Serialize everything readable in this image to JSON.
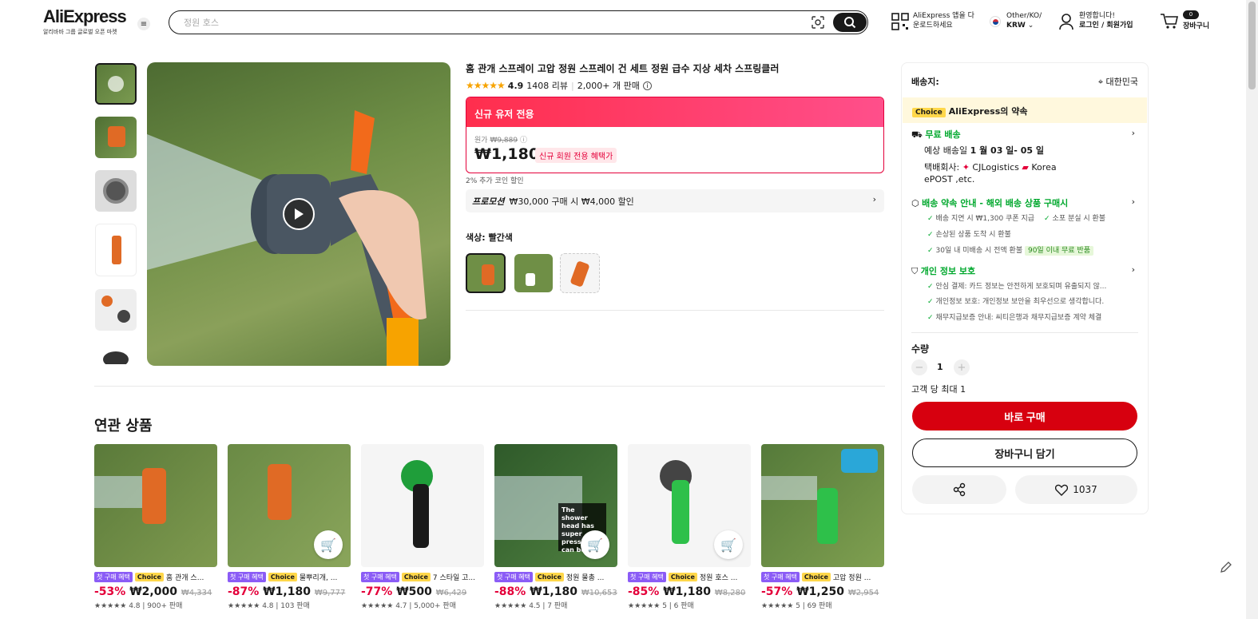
{
  "header": {
    "logo": "AliExpress",
    "logo_sub": "알리바바 그룹 글로벌 오픈 마켓",
    "search_placeholder": "정원 호스",
    "app_line1": "AliExpress 앱을 다",
    "app_line2": "운로드하세요",
    "region_line1": "Other/KO/",
    "region_line2": "KRW",
    "user_line1": "환영합니다!",
    "user_line2": "로그인 / 회원가입",
    "cart_count": "0",
    "cart_label": "장바구니"
  },
  "product": {
    "title": "홈 관개 스프레이 고압 정원 스프레이 건 세트 정원 급수 지상 세차 스프링클러",
    "stars": "★★★★★",
    "rating": "4.9",
    "reviews": "1408 리뷰",
    "sold": "2,000+ 개 판매",
    "promo_header": "신규 유저 전용",
    "original_label": "원가",
    "original_price": "₩9,889",
    "price": "₩1,180",
    "price_tag": "신규 회원 전용 혜택가",
    "coin": "2% 추가 코인 할인",
    "promotion_label": "프로모션",
    "promotion_text": "₩30,000 구매 시 ₩4,000 할인",
    "color_label": "색상: 빨간색"
  },
  "related": {
    "title": "연관 상품",
    "items": [
      {
        "badge1": "첫 구매 혜택",
        "badge2": "Choice",
        "name": "홈 관개 스...",
        "discount": "-53%",
        "price": "₩2,000",
        "orig": "₩4,334",
        "rating": "★★★★★ 4.8 | 900+ 판매"
      },
      {
        "badge1": "첫 구매 혜택",
        "badge2": "Choice",
        "name": "물뿌리개, ...",
        "discount": "-87%",
        "price": "₩1,180",
        "orig": "₩9,777",
        "rating": "★★★★★ 4.8 | 103 판매"
      },
      {
        "badge1": "첫 구매 혜택",
        "badge2": "Choice",
        "name": "7 스타일 고...",
        "discount": "-77%",
        "price": "₩500",
        "orig": "₩6,429",
        "rating": "★★★★★ 4.7 | 5,000+ 판매"
      },
      {
        "badge1": "첫 구매 혜택",
        "badge2": "Choice",
        "name": "정원 물총 ...",
        "discount": "-88%",
        "price": "₩1,180",
        "orig": "₩10,653",
        "rating": "★★★★★ 4.5 | 7 판매"
      },
      {
        "badge1": "첫 구매 혜택",
        "badge2": "Choice",
        "name": "정원 호스 ...",
        "discount": "-85%",
        "price": "₩1,180",
        "orig": "₩8,280",
        "rating": "★★★★★ 5 | 6 판매"
      },
      {
        "badge1": "첫 구매 혜택",
        "badge2": "Choice",
        "name": "고압 정원 ...",
        "discount": "-57%",
        "price": "₩1,250",
        "orig": "₩2,954",
        "rating": "★★★★★ 5 | 69 판매"
      }
    ],
    "overlay_text": "The shower head has super pressure can be"
  },
  "panel": {
    "ship_to_label": "배송지:",
    "ship_to_value": "대한민국",
    "choice_badge": "Choice",
    "choice_title": "AliExpress의 약속",
    "free_ship": "무료 배송",
    "eta_prefix": "예상 배송일",
    "eta": "1 월 03 일- 05 일",
    "carrier_label": "택배회사:",
    "carrier1": "CJLogistics",
    "carrier2": "Korea",
    "carrier3": "ePOST ,etc.",
    "guarantee_title": "배송 약속 안내 - 해외 배송 상품 구매시",
    "g1": "배송 지연 시 ₩1,300 쿠폰 지급",
    "g2": "소포 분실 시 환불",
    "g3": "손상된 상품 도착 시 환불",
    "g4": "30일 내 미배송 시 전액 환불",
    "g4_badge": "90일 이내 무료 반품",
    "privacy_title": "개인 정보 보호",
    "p1": "안심 결제: 카드 정보는 안전하게 보호되며 유출되지 않...",
    "p2": "개인정보 보호: 개인정보 보안을 최우선으로 생각합니다.",
    "p3": "채무지급보증 안내: 씨티은행과 채무지급보증 계약 체결",
    "qty_label": "수량",
    "qty_minus": "−",
    "qty_value": "1",
    "qty_plus": "+",
    "max_per_customer": "고객 당 최대 1",
    "buy_now": "바로 구매",
    "add_to_cart": "장바구니 담기",
    "wishlist_count": "1037"
  }
}
